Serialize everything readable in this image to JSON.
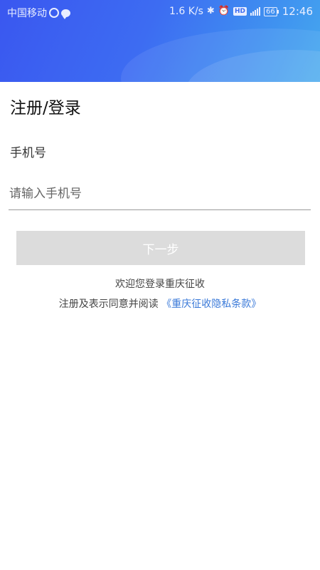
{
  "status_bar": {
    "carrier": "中国移动",
    "speed": "1.6 K/s",
    "network_badge": "HD",
    "battery": "66",
    "time": "12:46",
    "icons": [
      "sync-ring-icon",
      "chat-bubble-icon",
      "bluetooth-icon",
      "alarm-icon",
      "hd-icon",
      "signal-icon",
      "battery-icon"
    ]
  },
  "page": {
    "title": "注册/登录",
    "phone_label": "手机号",
    "phone_placeholder": "请输入手机号",
    "phone_value": "",
    "next_button": "下一步",
    "welcome_text": "欢迎您登录重庆征收",
    "agree_prefix": "注册及表示同意并阅读 ",
    "policy_link": "《重庆征收隐私条款》"
  },
  "colors": {
    "header_gradient_start": "#3a57f0",
    "header_gradient_end": "#46a9ee",
    "button_disabled": "#dcdcdc",
    "link": "#3a79d8"
  }
}
